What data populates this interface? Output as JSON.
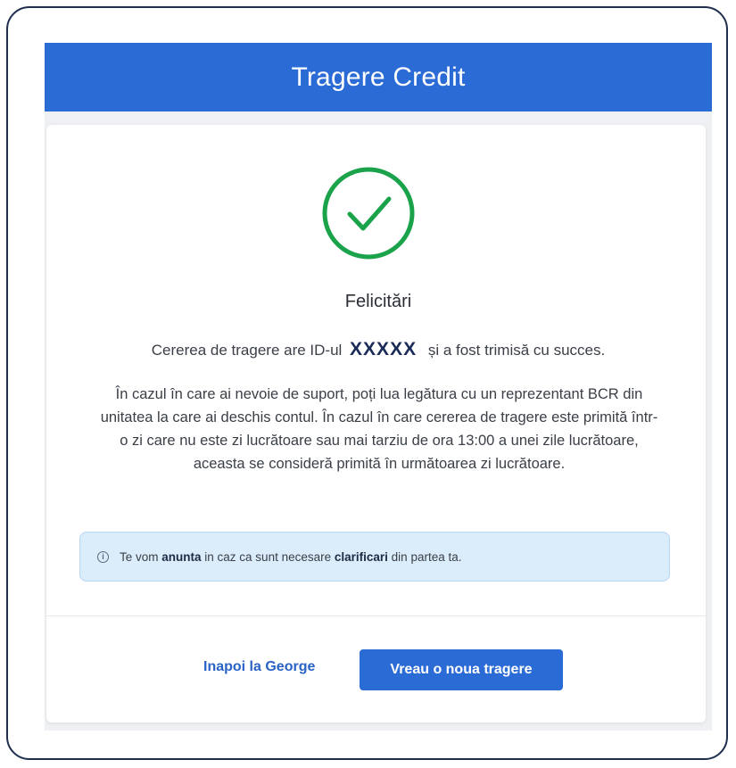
{
  "header": {
    "title": "Tragere Credit"
  },
  "success": {
    "icon": "check-circle-icon",
    "title": "Felicitări",
    "id_prefix": "Cererea de tragere are ID-ul",
    "id_value": "XXXXX",
    "id_suffix": "și a fost trimisă cu succes.",
    "description": "În cazul în care ai nevoie de suport, poți lua legătura cu un reprezentant BCR din unitatea la care ai deschis contul. În cazul în care cererea de tragere este primită într-o zi care nu este zi lucrătoare sau mai tarziu de ora 13:00 a unei zile lucrătoare, aceasta se consideră primită în următoarea zi lucrătoare."
  },
  "info": {
    "icon": "info-icon",
    "part1": "Te vom ",
    "bold1": "anunta",
    "part2": " in caz ca sunt necesare ",
    "bold2": "clarificari",
    "part3": " din partea ta."
  },
  "actions": {
    "back_label": "Inapoi la George",
    "new_label": "Vreau o noua tragere"
  },
  "colors": {
    "primary": "#2a6bd6",
    "success": "#1aa34a",
    "info_bg": "#dbecfb"
  }
}
